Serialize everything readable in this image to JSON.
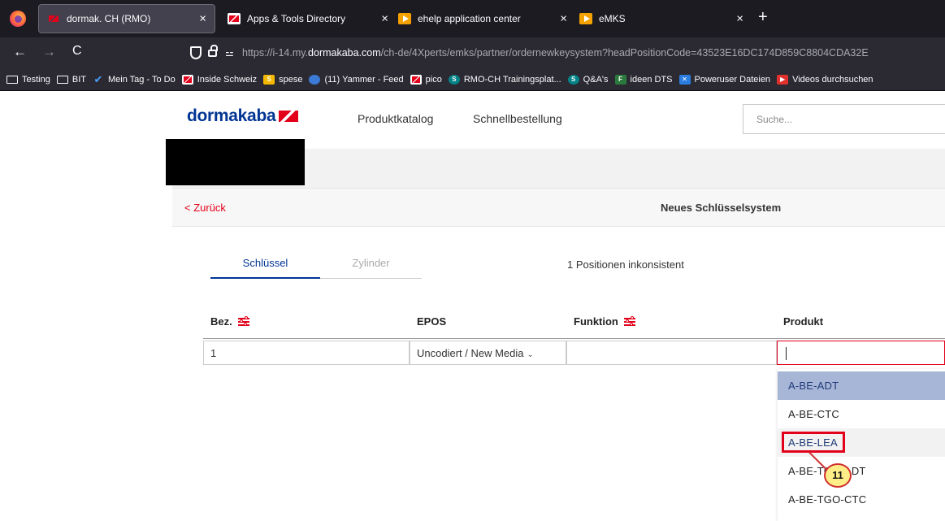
{
  "browser": {
    "tabs": [
      {
        "title": "dormak. CH (RMO)",
        "active": true
      },
      {
        "title": "Apps & Tools Directory",
        "active": false
      },
      {
        "title": "ehelp application center",
        "active": false
      },
      {
        "title": "eMKS",
        "active": false
      }
    ],
    "close_glyph": "×",
    "new_tab_glyph": "+",
    "back_glyph": "←",
    "forward_glyph": "→",
    "reload_glyph": "C",
    "url_prefix": "https://i-14.my.",
    "url_domain": "dormakaba.com",
    "url_path": "/ch-de/4Xperts/emks/partner/ordernewkeysystem?headPositionCode=43523E16DC174D859C8804CDA32E",
    "bookmarks": [
      {
        "label": "Testing",
        "icon": "folder-icon"
      },
      {
        "label": "BIT",
        "icon": "folder-icon"
      },
      {
        "label": "Mein Tag - To Do",
        "icon": "check-icon"
      },
      {
        "label": "Inside Schweiz",
        "icon": "dormakaba-icon"
      },
      {
        "label": "spese",
        "icon": "s-icon"
      },
      {
        "label": "(11) Yammer - Feed",
        "icon": "yammer-icon"
      },
      {
        "label": "pico",
        "icon": "dormakaba-icon"
      },
      {
        "label": "RMO-CH Trainingsplat...",
        "icon": "sharepoint-icon"
      },
      {
        "label": "Q&A's",
        "icon": "sharepoint-icon"
      },
      {
        "label": "ideen DTS",
        "icon": "grid-icon"
      },
      {
        "label": "Poweruser Dateien",
        "icon": "tools-icon"
      },
      {
        "label": "Videos durchsuchen",
        "icon": "play-icon"
      }
    ]
  },
  "header": {
    "logo_text": "dormakaba",
    "nav": [
      "Produktkatalog",
      "Schnellbestellung"
    ],
    "search_placeholder": "Suche..."
  },
  "subbar": {
    "back_label": "< Zurück",
    "title": "Neues Schlüsselsystem"
  },
  "tabs": {
    "active": "Schlüssel",
    "inactive": "Zylinder"
  },
  "status_text": "1 Positionen inkonsistent",
  "table": {
    "headers": [
      "Bez.",
      "EPOS",
      "Funktion",
      "Produkt"
    ],
    "row": {
      "bez": "1",
      "epos": "Uncodiert / New Media",
      "funktion": "",
      "produkt": ""
    }
  },
  "dropdown": {
    "options": [
      "A-BE-ADT",
      "A-BE-CTC",
      "A-BE-LEA",
      "A-BE-TGO-ADT",
      "A-BE-TGO-CTC"
    ],
    "selected": "A-BE-ADT",
    "hovered": "A-BE-LEA"
  },
  "callout_number": "11",
  "colors": {
    "brand_blue": "#003594",
    "brand_red": "#e2001a"
  }
}
